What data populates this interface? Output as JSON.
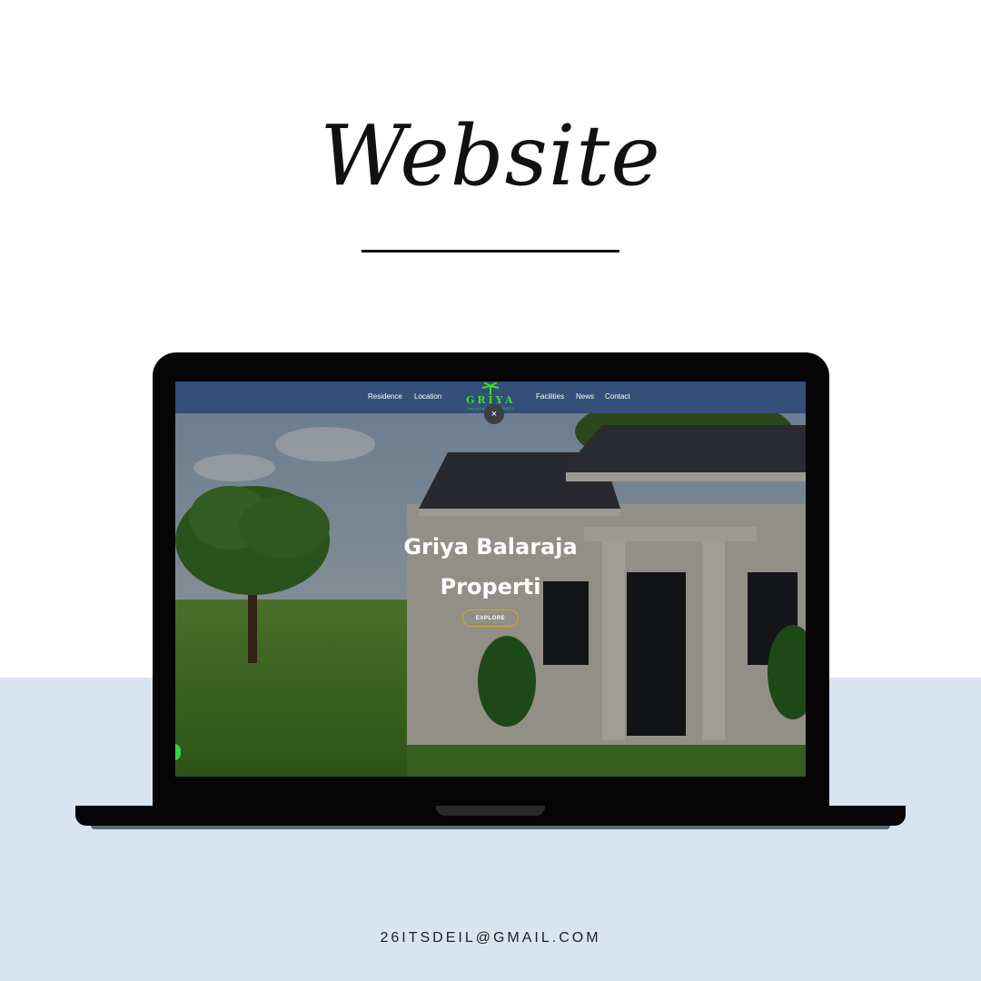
{
  "page": {
    "heading": "Website",
    "email": "26ITSDEIL@GMAIL.COM"
  },
  "site": {
    "nav": {
      "left": [
        "Residence",
        "Location"
      ],
      "right": [
        "Facilities",
        "News",
        "Contact"
      ]
    },
    "logo": {
      "text": "GRIYA",
      "subtext": "BALARAJA PROPERTI",
      "color": "#3ddc2a"
    },
    "hero": {
      "title_line1": "Griya Balaraja",
      "title_line2": "Properti",
      "cta_label": "EXPLORE"
    },
    "close_symbol": "×",
    "colors": {
      "navbar": "#334f7a",
      "cta_border": "#d9a331",
      "chat_button": "#39d04a",
      "lower_background": "#d8e4f0"
    }
  }
}
